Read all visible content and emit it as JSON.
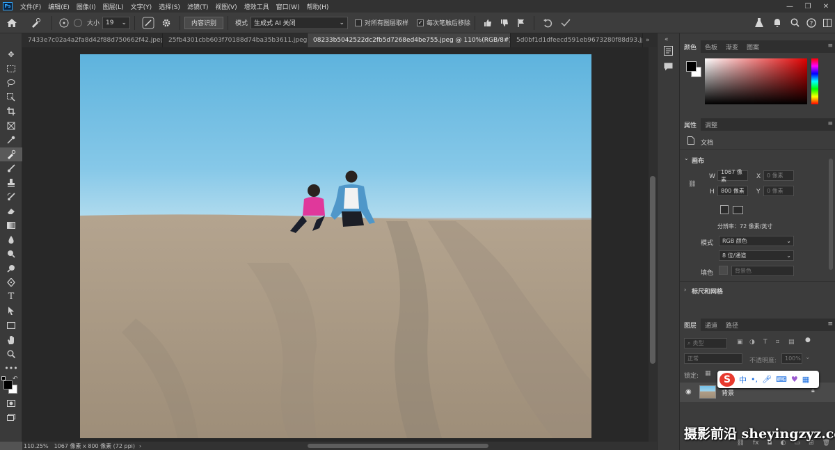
{
  "menubar": {
    "logo": "Ps",
    "items": [
      "文件(F)",
      "编辑(E)",
      "图像(I)",
      "图层(L)",
      "文字(Y)",
      "选择(S)",
      "滤镜(T)",
      "视图(V)",
      "增效工具",
      "窗口(W)",
      "帮助(H)"
    ],
    "window_controls": [
      "—",
      "❐",
      "✕"
    ]
  },
  "options_bar": {
    "size_label": "大小",
    "size_value": "19",
    "content_aware_button": "内容识别",
    "mode_label": "模式",
    "mode_value": "生成式 AI 关闭",
    "sample_all_layers": "对所有图层取样",
    "sample_all_checked": false,
    "diffuse_label": "每次笔触后移除",
    "diffuse_checked": true
  },
  "tabs": [
    {
      "label": "7433e7c02a4a2fa8d42f88d750662f42.jpeg",
      "active": false
    },
    {
      "label": "25fb4301cbb603f70188d74ba35b3611.jpeg",
      "active": false
    },
    {
      "label": "08233b5042522dc2fb5d7268ed4be755.jpeg @ 110%(RGB/8#) *",
      "active": true
    },
    {
      "label": "5d0bf1d1dfeecd591eb9673280f88d93.jpe",
      "active": false
    }
  ],
  "status": {
    "zoom": "110.25%",
    "doc_info": "1067 像素 x 800 像素 (72 ppi)"
  },
  "color_panel": {
    "tabs": [
      "颜色",
      "色板",
      "渐变",
      "图案"
    ],
    "foreground": "#000000",
    "background": "#ffffff",
    "hue_color": "#e00000"
  },
  "properties_panel": {
    "tabs": [
      "属性",
      "调整"
    ],
    "doc_label": "文档",
    "canvas_section": "画布",
    "w_label": "W",
    "w_value": "1067 像素",
    "h_label": "H",
    "h_value": "800 像素",
    "x_label": "X",
    "x_value": "0 像素",
    "y_label": "Y",
    "y_value": "0 像素",
    "resolution": "分辨率：72 像素/英寸",
    "mode_label": "模式",
    "mode_value": "RGB 颜色",
    "depth_value": "8 位/通道",
    "fill_label": "填色",
    "fill_value": "背景色",
    "rulers_section": "标尺和网格"
  },
  "layers_panel": {
    "tabs": [
      "图层",
      "通道",
      "路径"
    ],
    "filter_placeholder": "类型",
    "blend_mode": "正常",
    "opacity_label": "不透明度:",
    "opacity_value": "100%",
    "lock_label": "锁定:",
    "layers": [
      {
        "name": "背景",
        "visible": true,
        "locked": true
      }
    ]
  },
  "ime_bar": {
    "chinese": "中"
  },
  "watermark": "摄影前沿 sheyingzyz.com"
}
